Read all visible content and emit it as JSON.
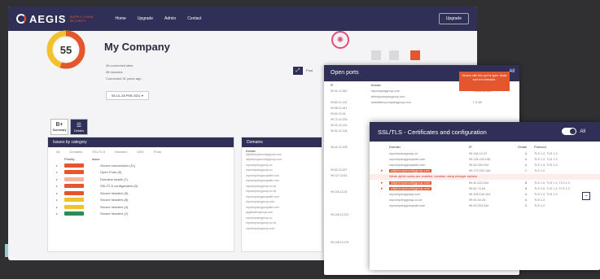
{
  "nav": {
    "logo": "AEGIS",
    "logo_sub": "SUPPLY CHAIN SECURITY",
    "links": [
      "Home",
      "Upgrade",
      "Admin",
      "Contact"
    ],
    "upgrade_label": "Upgrade"
  },
  "summary": {
    "company": "My Company",
    "score": "55",
    "score_fraction": 0.55,
    "meta": [
      "28 connected sites",
      "38 domains",
      "Connected 31 years ago"
    ],
    "date": "05.10–28 FEB 2021",
    "small_button_label": "Post"
  },
  "tabs": [
    {
      "icon": "B+",
      "label": "Summary"
    },
    {
      "icon": "☰",
      "label": "Details"
    }
  ],
  "issues": {
    "title": "Issues by category",
    "categories": [
      "All",
      "Domains",
      "SSL/TLS",
      "Headers",
      "DNS",
      "Ports"
    ],
    "columns": [
      "Priority",
      "Issue"
    ],
    "rows": [
      {
        "color": "#e4572e",
        "text": "Secure connections (11)"
      },
      {
        "color": "#e4572e",
        "text": "Open Ports (8)"
      },
      {
        "color": "#f7b2a3",
        "text": "Domains health (7)"
      },
      {
        "color": "#e4572e",
        "text": "SSL/TLS configuration (8)"
      },
      {
        "color": "#e4572e",
        "text": "Secure headers (8)"
      },
      {
        "color": "#f2c12e",
        "text": "Secure headers (8)"
      },
      {
        "color": "#f2c12e",
        "text": "Secure headers (4)"
      },
      {
        "color": "#2e8b57",
        "text": "Secure headers (2)"
      }
    ]
  },
  "domains": {
    "title": "Domains",
    "header": "Domain",
    "rows": [
      "sillytheorysecuritygroup.com",
      "sillytheorysecuritygroup.com",
      "mycompanygroup.co",
      "mycompanygroup.co",
      "mycompanygroupsite.com",
      "mycompanygroupsite.com",
      "mycompanygroup.co.uk",
      "mycompanygroup.co.uk",
      "mycompanygroupsite.com",
      "mycompanygroup.com",
      "mycompanygroupsite.com",
      "applicationgroup.com",
      "mycompanygroup.co",
      "mycompanygroup.co.uk",
      "mycompanygroup.com"
    ]
  },
  "ports": {
    "title": "Open ports",
    "toggle_label": "All",
    "tooltip": "Service with this port is open. Make sure it is intended.",
    "columns": [
      "IP",
      "Domain",
      "Port"
    ],
    "rows": [
      {
        "ip": "99.41.13.262",
        "domain": "mycompanygroup.com",
        "port": "7.11.22.60.445"
      },
      {
        "ip": "",
        "domain": "webmycompanygroup.com",
        "port": ""
      },
      {
        "ip": "99.62.14.113",
        "domain": "availablemycompanygroup.com",
        "port": "7.11.80"
      },
      {
        "ip": "99.38.12.441",
        "domain": "",
        "port": ""
      },
      {
        "ip": "99.52.13.44",
        "domain": "",
        "port": ""
      },
      {
        "ip": "99.72.14.225",
        "domain": "",
        "port": ""
      },
      {
        "ip": "99.41.13.120",
        "domain": "",
        "port": ""
      },
      {
        "ip": "99.51.12.118",
        "domain": "",
        "port": ""
      },
      {
        "ip": "",
        "domain": "",
        "port": ""
      },
      {
        "ip": "",
        "domain": "",
        "port": ""
      },
      {
        "ip": "99.41.12.128",
        "domain": "",
        "port": ""
      },
      {
        "ip": "",
        "domain": "",
        "port": ""
      },
      {
        "ip": "",
        "domain": "",
        "port": ""
      },
      {
        "ip": "",
        "domain": "",
        "port": ""
      },
      {
        "ip": "99.51.13.227",
        "domain": "",
        "port": ""
      },
      {
        "ip": "99.127.13.61",
        "domain": "",
        "port": ""
      },
      {
        "ip": "",
        "domain": "",
        "port": ""
      },
      {
        "ip": "",
        "domain": "",
        "port": ""
      },
      {
        "ip": "99.136.13.24",
        "domain": "",
        "port": ""
      },
      {
        "ip": "",
        "domain": "",
        "port": ""
      },
      {
        "ip": "",
        "domain": "",
        "port": ""
      },
      {
        "ip": "",
        "domain": "",
        "port": ""
      },
      {
        "ip": "99.146.13.221",
        "domain": "",
        "port": ""
      },
      {
        "ip": "",
        "domain": "",
        "port": ""
      },
      {
        "ip": "",
        "domain": "",
        "port": ""
      },
      {
        "ip": "",
        "domain": "",
        "port": ""
      },
      {
        "ip": "",
        "domain": "",
        "port": ""
      },
      {
        "ip": "99.148.13.176",
        "domain": "mycompanygroup.co",
        "port": "7.11.80.443"
      }
    ]
  },
  "ssl": {
    "title": "SSL/TLS - Certificates and configuration",
    "toggle_label": "All",
    "columns": [
      "Domain",
      "IP",
      "Grade",
      "Protocol"
    ],
    "rows": [
      {
        "chev": "",
        "domain": "mycompanygroup.co",
        "ip": "99.118.13.22",
        "grade": "A",
        "proto": "TLS 1.2, TLS 1.3",
        "warn": false
      },
      {
        "chev": "",
        "domain": "mycompanygroupsite.com",
        "ip": "99.118.130.196",
        "grade": "A",
        "proto": "TLS 1.2, TLS 1.3",
        "warn": false
      },
      {
        "chev": "",
        "domain": "mycompanygroupsite.com",
        "ip": "99.44.253.244",
        "grade": "A",
        "proto": "TLS 1.2, TLS 1.3",
        "warn": false
      },
      {
        "chev": "▸",
        "domain": "sillytheorysecuritygroup.com",
        "ip": "99.172.252.144",
        "grade": "C",
        "proto": "TLS 1.2",
        "warn": true
      },
      {
        "chev": "",
        "domain": "Weak cipher suites are enabled, consider using stronger ciphers",
        "ip": "",
        "grade": "",
        "proto": "",
        "warn": false,
        "alert": true
      },
      {
        "chev": "▸",
        "domain": "sillytheorysecuritygroup.com",
        "ip": "99.40.222.244",
        "grade": "B",
        "proto": "TLS 1.0, TLS 1.1, TLS 1.2",
        "warn": true
      },
      {
        "chev": "▸",
        "domain": "sillytheorysecuritygroup.com",
        "ip": "99.62.74.64",
        "grade": "B",
        "proto": "TLS 1.0, TLS 1.1, TLS 1.2",
        "warn": true
      },
      {
        "chev": "",
        "domain": "mycompanygroup.com",
        "ip": "99.108.130.104",
        "grade": "A",
        "proto": "TLS 1.2, TLS 1.3",
        "warn": false
      },
      {
        "chev": "",
        "domain": "mycompanygroup.co.uk",
        "ip": "99.44.53.43",
        "grade": "A",
        "proto": "TLS 1.2",
        "warn": false
      },
      {
        "chev": "",
        "domain": "mycompanygroupsite.com",
        "ip": "99.40.253.244",
        "grade": "A",
        "proto": "TLS 1.2",
        "warn": false
      }
    ]
  }
}
